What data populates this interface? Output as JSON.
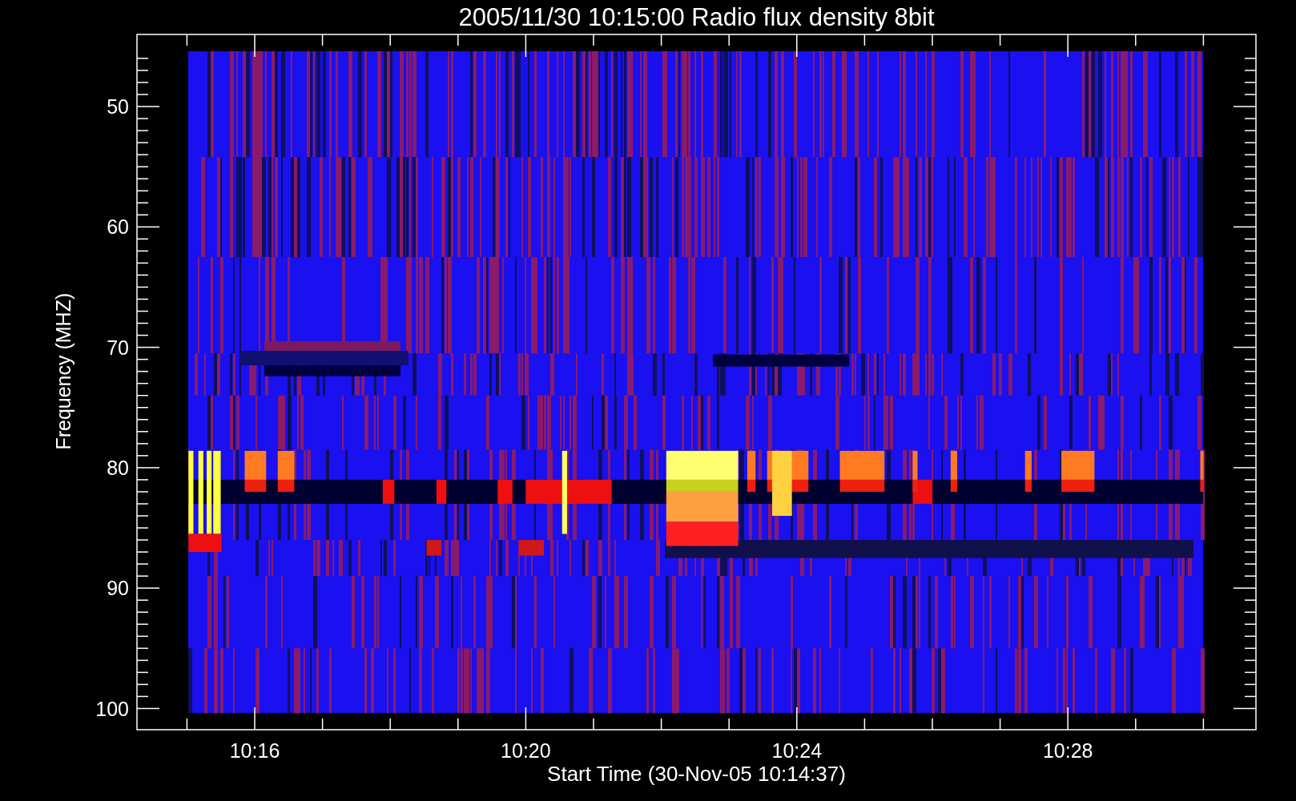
{
  "title": "2005/11/30 10:15:00 Radio flux density 8bit",
  "plot": {
    "ylabel": "Frequency (MHZ)",
    "xlabel": "Start Time (30-Nov-05 10:14:37)",
    "yticks": [
      "50",
      "60",
      "70",
      "80",
      "90",
      "100"
    ],
    "xticks": [
      "10:16",
      "10:20",
      "10:24",
      "10:28"
    ]
  }
}
